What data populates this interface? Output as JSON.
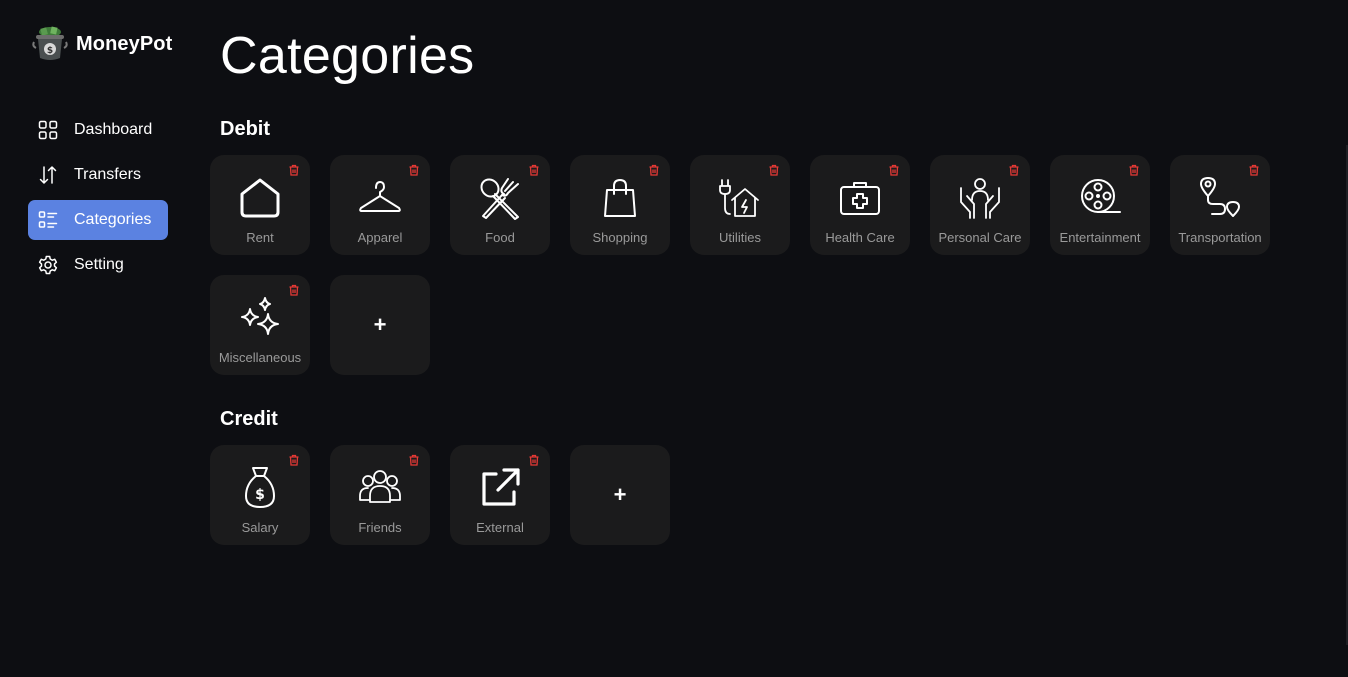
{
  "brand": {
    "name": "MoneyPot",
    "logo_icon": "money-pot-icon"
  },
  "nav": {
    "items": [
      {
        "label": "Dashboard",
        "icon": "dashboard-grid-icon",
        "active": false
      },
      {
        "label": "Transfers",
        "icon": "transfer-arrows-icon",
        "active": false
      },
      {
        "label": "Categories",
        "icon": "categories-list-icon",
        "active": true
      },
      {
        "label": "Setting",
        "icon": "gear-icon",
        "active": false
      }
    ]
  },
  "page": {
    "title": "Categories"
  },
  "debit": {
    "title": "Debit",
    "items": [
      {
        "label": "Rent",
        "icon": "house-icon"
      },
      {
        "label": "Apparel",
        "icon": "hanger-icon"
      },
      {
        "label": "Food",
        "icon": "fork-spoon-icon"
      },
      {
        "label": "Shopping",
        "icon": "shopping-bag-icon"
      },
      {
        "label": "Utilities",
        "icon": "house-plug-icon"
      },
      {
        "label": "Health Care",
        "icon": "first-aid-kit-icon"
      },
      {
        "label": "Personal Care",
        "icon": "person-hands-icon"
      },
      {
        "label": "Entertainment",
        "icon": "film-reel-icon"
      },
      {
        "label": "Transportation",
        "icon": "route-pin-icon"
      },
      {
        "label": "Miscellaneous",
        "icon": "sparkles-icon"
      }
    ],
    "add_label": "+"
  },
  "credit": {
    "title": "Credit",
    "items": [
      {
        "label": "Salary",
        "icon": "money-bag-icon"
      },
      {
        "label": "Friends",
        "icon": "people-group-icon"
      },
      {
        "label": "External",
        "icon": "external-link-icon"
      }
    ],
    "add_label": "+"
  },
  "colors": {
    "background": "#0d0e12",
    "card": "#1b1b1c",
    "accent": "#5b82e1",
    "delete": "#e53935",
    "label": "#9a9a9a"
  }
}
